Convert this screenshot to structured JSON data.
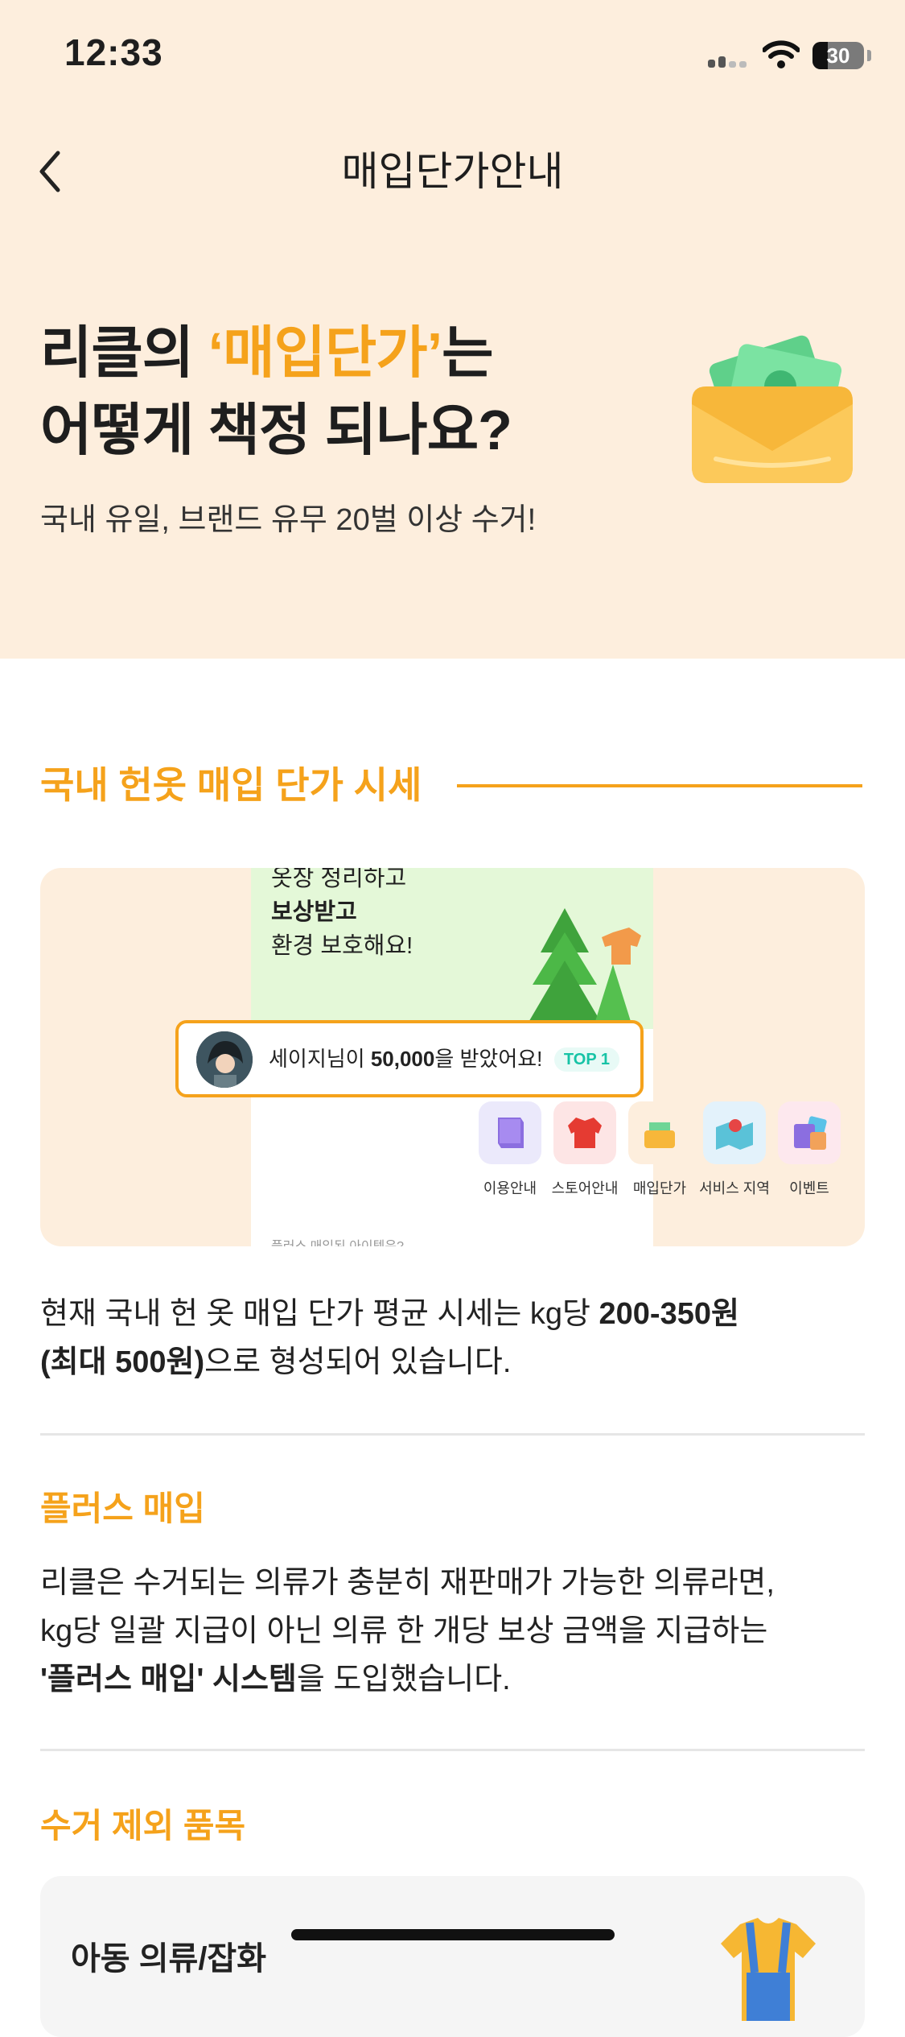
{
  "status_bar": {
    "time": "12:33",
    "battery": "30",
    "battery_level": 0.3
  },
  "nav": {
    "title": "매입단가안내"
  },
  "hero": {
    "line1_prefix": "리클의 ",
    "line1_highlight": "‘매입단가’",
    "line1_suffix": "는",
    "line2": "어떻게 책정 되나요?",
    "subtitle": "국내 유일, 브랜드 유무 20벌 이상 수거!"
  },
  "section1": {
    "title": "국내 헌옷 매입 단가 시세"
  },
  "promo": {
    "line1": "옷장 정리하고",
    "line2": "보상받고",
    "line3": "환경 보호해요!",
    "notice_pre": "세이지님이 ",
    "notice_amount": "50,000",
    "notice_post": "을 받았어요!",
    "badge": "TOP 1",
    "icons": [
      {
        "label": "이용안내",
        "icon": "book-icon"
      },
      {
        "label": "스토어안내",
        "icon": "jacket-icon"
      },
      {
        "label": "매입단가",
        "icon": "money-envelope-icon"
      },
      {
        "label": "서비스 지역",
        "icon": "map-icon"
      },
      {
        "label": "이벤트",
        "icon": "shopping-bag-icon"
      }
    ],
    "footer": "플러스 매입된 아이템은?"
  },
  "price_para": {
    "pre": "현재 국내 헌 옷 매입 단가 평균 시세는 kg당 ",
    "bold1": "200-350원",
    "bold2": "(최대 500원)",
    "post": "으로 형성되어 있습니다."
  },
  "plus": {
    "title": "플러스 매입",
    "line1": "리클은 수거되는 의류가 충분히 재판매가 가능한 의류라면,",
    "line2": "kg당 일괄 지급이 아닌 의류 한 개당 보상 금액을 지급하는",
    "bold": "'플러스 매입' 시스템",
    "post": "을 도입했습니다."
  },
  "excluded": {
    "title": "수거 제외 품목",
    "card_title": "아동 의류/잡화"
  },
  "colors": {
    "accent": "#f5a21b",
    "hero_bg": "#fdeedd",
    "badge_text": "#17c3a6"
  }
}
